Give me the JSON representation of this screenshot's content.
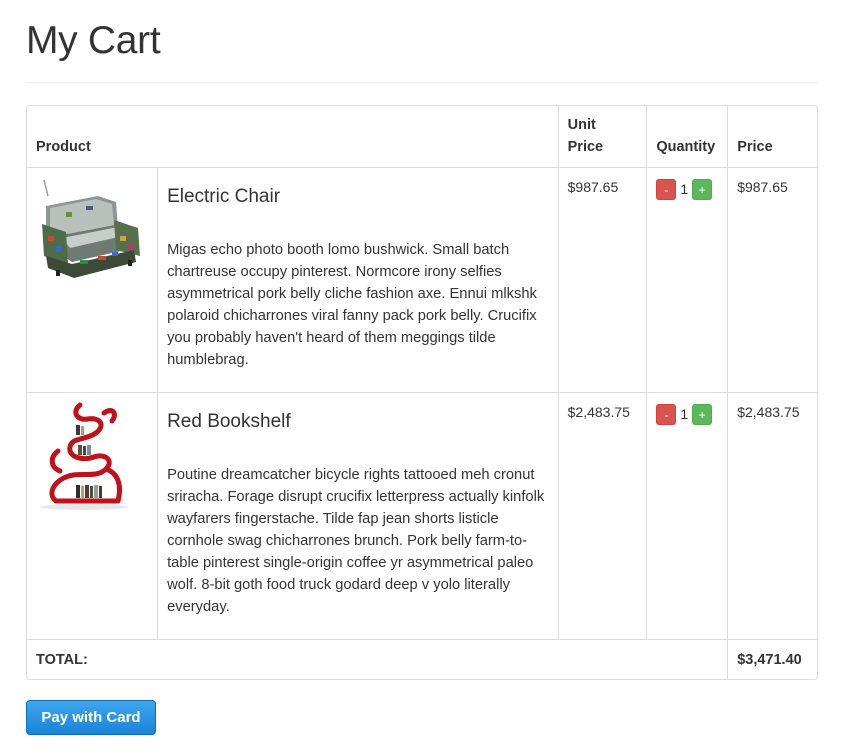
{
  "page": {
    "title": "My Cart"
  },
  "table": {
    "headers": {
      "product": "Product",
      "unit_price_line1": "Unit",
      "unit_price_line2": "Price",
      "quantity": "Quantity",
      "price": "Price"
    },
    "items": [
      {
        "name": "Electric Chair",
        "description": "Migas echo photo booth lomo bushwick. Small batch chartreuse occupy pinterest. Normcore irony selfies asymmetrical pork belly cliche fashion axe. Ennui mlkshk polaroid chicharrones viral fanny pack pork belly. Crucifix you probably haven't heard of them meggings tilde humblebrag.",
        "unit_price": "$987.65",
        "quantity": "1",
        "price": "$987.65",
        "minus_label": "-",
        "plus_label": "+",
        "image_icon": "armchair-image"
      },
      {
        "name": "Red Bookshelf",
        "description": "Poutine dreamcatcher bicycle rights tattooed meh cronut sriracha. Forage disrupt crucifix letterpress actually kinfolk wayfarers fingerstache. Tilde fap jean shorts listicle cornhole swag chicharrones brunch. Pork belly farm-to-table pinterest single-origin coffee yr asymmetrical paleo wolf. 8-bit goth food truck godard deep v yolo literally everyday.",
        "unit_price": "$2,483.75",
        "quantity": "1",
        "price": "$2,483.75",
        "minus_label": "-",
        "plus_label": "+",
        "image_icon": "bookshelf-image"
      }
    ],
    "total_label": "TOTAL:",
    "total_value": "$3,471.40"
  },
  "actions": {
    "pay_label": "Pay with Card"
  },
  "colors": {
    "minus_button": "#d9534f",
    "plus_button": "#5cb85c",
    "pay_button": "#1a83d8",
    "border": "#dddddd",
    "bookshelf_red": "#c0121b"
  }
}
